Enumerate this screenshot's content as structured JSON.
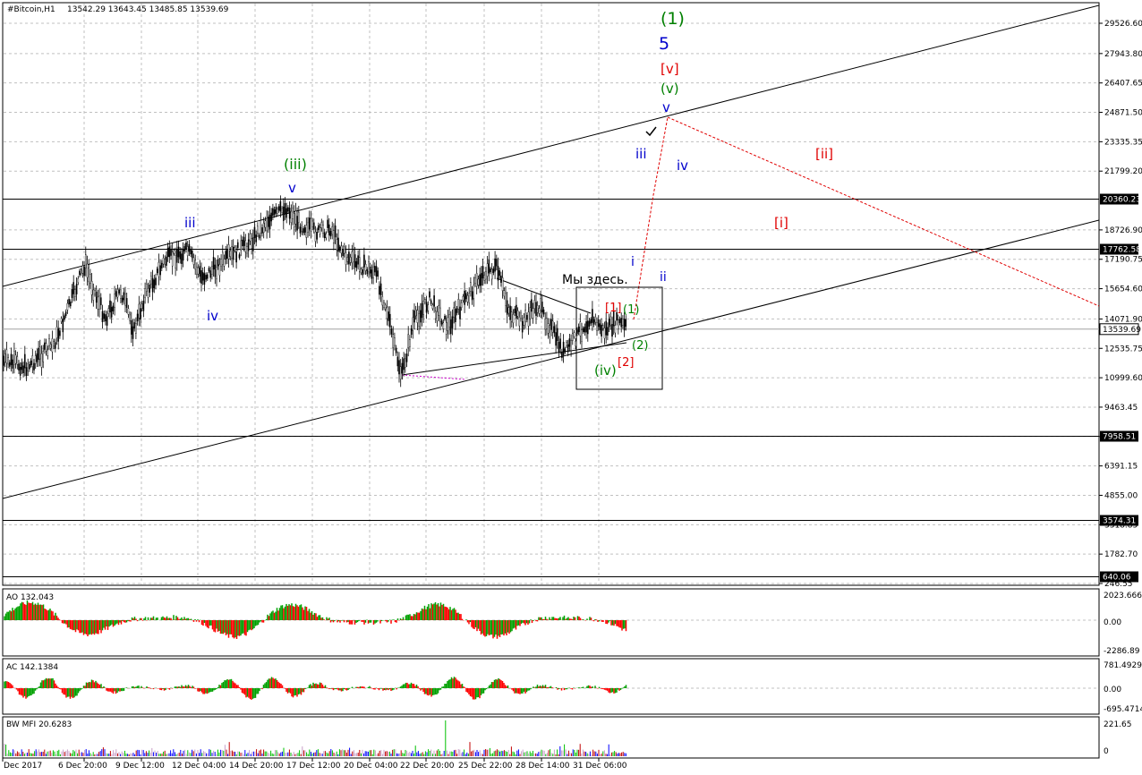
{
  "header": {
    "symbol": "#Bitcoin,H1",
    "ohlc": "13542.29 13643.45 13485.85 13539.69"
  },
  "chart_data": {
    "type": "candlestick",
    "symbol": "#Bitcoin",
    "timeframe": "H1",
    "last_price": "13539.69",
    "y_ticks": [
      "29526.60",
      "27943.80",
      "26407.65",
      "24871.50",
      "23335.35",
      "21799.20",
      "18726.90",
      "17190.75",
      "15654.60",
      "14071.90",
      "12535.75",
      "10999.60",
      "9463.45",
      "7927.30",
      "6391.15",
      "4855.00",
      "3318.85",
      "1782.70",
      "246.55"
    ],
    "y_range": [
      246.55,
      30500
    ],
    "horizontal_levels": [
      {
        "value": "20360.23"
      },
      {
        "value": "17762.58"
      },
      {
        "value": "7958.51"
      },
      {
        "value": "3574.31"
      },
      {
        "value": "640.06"
      }
    ],
    "x_ticks": [
      "Dec 2017",
      "6 Dec 20:00",
      "9 Dec 12:00",
      "12 Dec 04:00",
      "14 Dec 20:00",
      "17 Dec 12:00",
      "20 Dec 04:00",
      "22 Dec 20:00",
      "25 Dec 22:00",
      "28 Dec 14:00",
      "31 Dec 06:00"
    ],
    "wave_labels": {
      "green": [
        "(1)",
        "(iii)",
        "(v)",
        "(1)",
        "(2)",
        "(iv)"
      ],
      "blue": [
        "5",
        "v",
        "iii",
        "iii",
        "iv",
        "iv",
        "v",
        "i",
        "ii"
      ],
      "red": [
        "[v]",
        "[ii]",
        "[i]",
        "[1]",
        "[2]"
      ],
      "note": "Мы здесь."
    }
  },
  "indicators": {
    "ao": {
      "label": "AO 132.043",
      "ticks": [
        "2023.666",
        "0.00",
        "-2286.89"
      ]
    },
    "ac": {
      "label": "AC 142.1384",
      "ticks": [
        "781.4929",
        "0.00",
        "-695.4714"
      ]
    },
    "mfi": {
      "label": "BW MFI 20.6283",
      "ticks": [
        "221.65",
        "0"
      ]
    }
  },
  "colors": {
    "up": "#00a000",
    "down": "#ff0000",
    "label_green": "#008000",
    "label_blue": "#0000cc",
    "label_red": "#e00000",
    "mfi_green": "#00c000",
    "mfi_blue": "#0000ff"
  }
}
